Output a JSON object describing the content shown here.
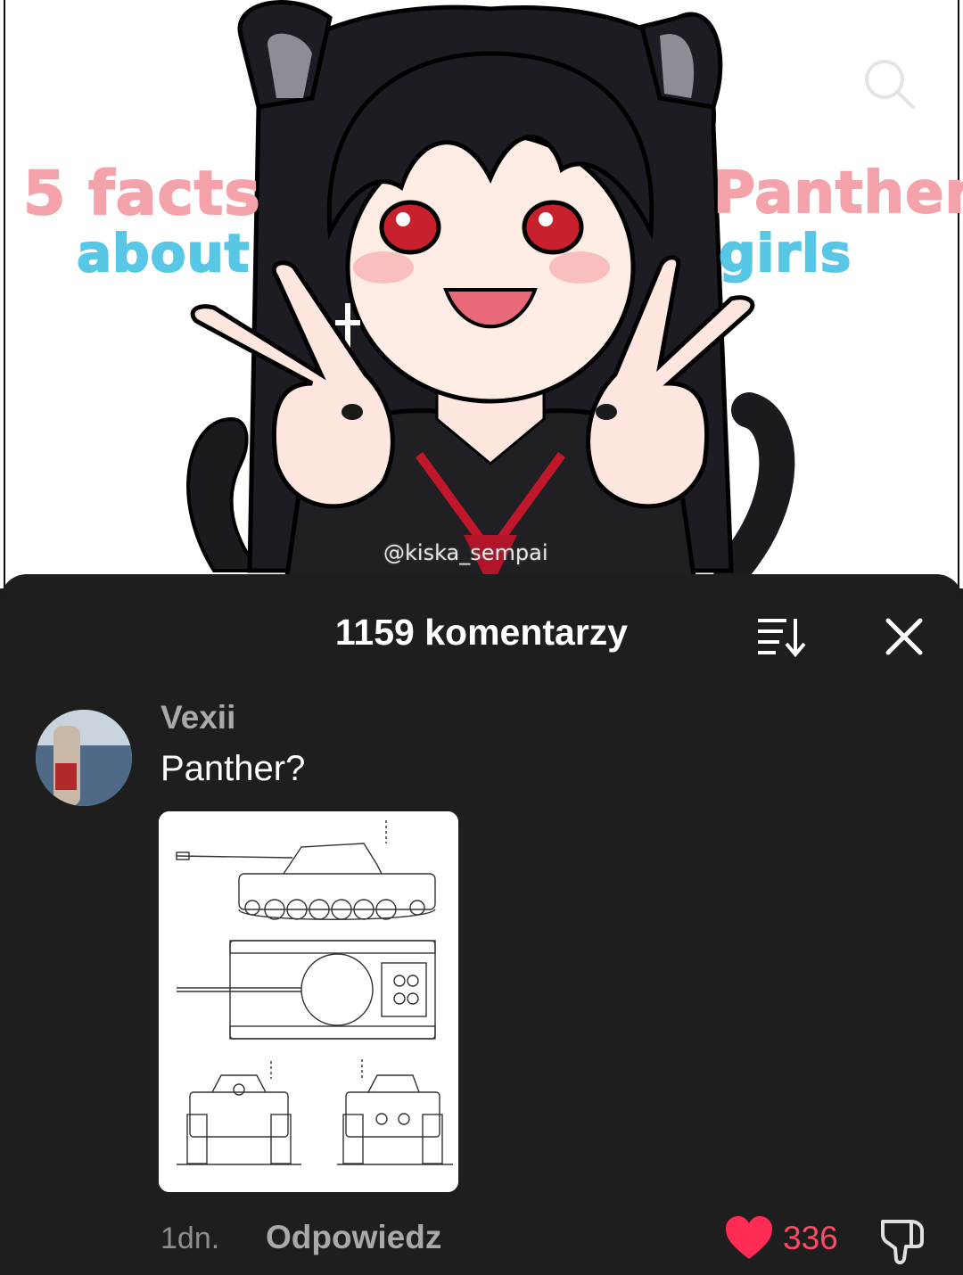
{
  "video": {
    "thumbnail_text": {
      "line1": "5 facts",
      "line2": "about",
      "line3": "Panther",
      "line4": "girls"
    },
    "watermark": "@kiska_sempai",
    "search_icon": "search-icon"
  },
  "comments_sheet": {
    "title": "1159 komentarzy",
    "sort_icon": "sort-icon",
    "close_icon": "close-icon"
  },
  "comment": {
    "username": "Vexii",
    "text": "Panther?",
    "image": "tank-blueprint",
    "timestamp": "1dn.",
    "reply_label": "Odpowiedz",
    "like_count": "336",
    "liked": true,
    "colors": {
      "like": "#fe2c55",
      "like_count": "#fe4a64"
    }
  }
}
